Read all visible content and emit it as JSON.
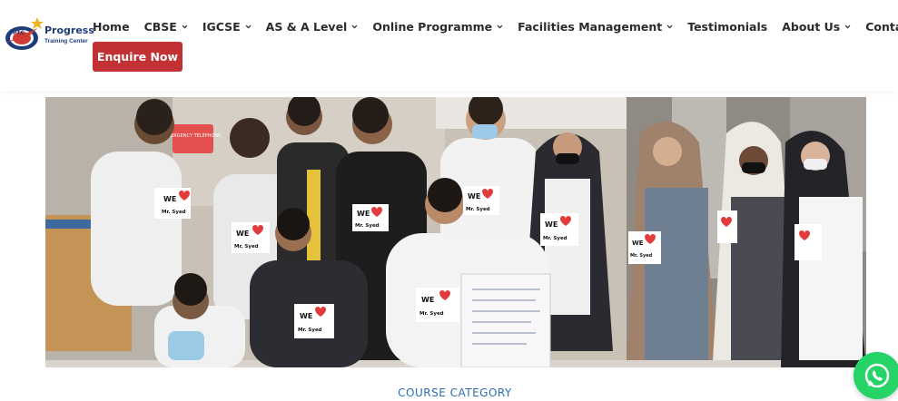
{
  "brand": {
    "name": "Progress",
    "subtitle": "Training Center",
    "badge": "PTC"
  },
  "nav": {
    "items": [
      {
        "label": "Home",
        "dropdown": false
      },
      {
        "label": "CBSE",
        "dropdown": true
      },
      {
        "label": "IGCSE",
        "dropdown": true
      },
      {
        "label": "AS & A Level",
        "dropdown": true
      },
      {
        "label": "Online Programme",
        "dropdown": true
      },
      {
        "label": "Facilities Management",
        "dropdown": true
      },
      {
        "label": "Testimonials",
        "dropdown": false
      },
      {
        "label": "About Us",
        "dropdown": true
      },
      {
        "label": "Contact Us",
        "dropdown": false
      }
    ]
  },
  "cta": {
    "label": "Enquire Now"
  },
  "hero": {
    "shirt_text_top": "WE",
    "shirt_text_bottom": "Mr. Syed",
    "sign_text": "EMERGENCY TELEPHONE"
  },
  "section": {
    "category_label": "COURSE CATEGORY"
  },
  "colors": {
    "accent_red": "#c23234",
    "brand_blue": "#1f3c7a",
    "link_blue": "#2c6db5",
    "whatsapp_green": "#25d366"
  },
  "icons": {
    "chevron": "chevron-down-icon",
    "whatsapp": "whatsapp-icon"
  }
}
